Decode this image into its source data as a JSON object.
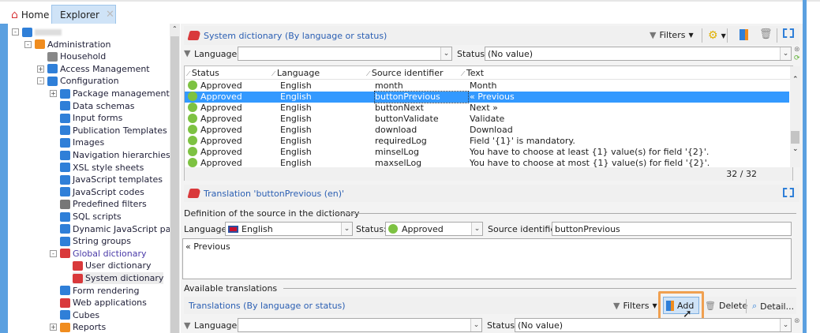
{
  "tabs": {
    "home": "Home",
    "explorer": "Explorer"
  },
  "tree": [
    {
      "label": "",
      "level": 0,
      "toggle": "-",
      "color": "#2f7fd8",
      "blurred": true
    },
    {
      "label": "Administration",
      "level": 1,
      "toggle": "-",
      "color": "#f08c1e"
    },
    {
      "label": "Household",
      "level": 2,
      "color": "#888"
    },
    {
      "label": "Access Management",
      "level": 2,
      "toggle": "+",
      "color": "#2f7fd8"
    },
    {
      "label": "Configuration",
      "level": 2,
      "toggle": "-",
      "color": "#2f7fd8"
    },
    {
      "label": "Package management",
      "level": 3,
      "toggle": "+",
      "color": "#2f7fd8"
    },
    {
      "label": "Data schemas",
      "level": 3,
      "color": "#2f7fd8"
    },
    {
      "label": "Input forms",
      "level": 3,
      "color": "#2f7fd8"
    },
    {
      "label": "Publication Templates",
      "level": 3,
      "color": "#2f7fd8"
    },
    {
      "label": "Images",
      "level": 3,
      "color": "#2f7fd8"
    },
    {
      "label": "Navigation hierarchies",
      "level": 3,
      "color": "#2f7fd8"
    },
    {
      "label": "XSL style sheets",
      "level": 3,
      "color": "#2f7fd8"
    },
    {
      "label": "JavaScript templates",
      "level": 3,
      "color": "#2f7fd8"
    },
    {
      "label": "JavaScript codes",
      "level": 3,
      "color": "#2f7fd8"
    },
    {
      "label": "Predefined filters",
      "level": 3,
      "color": "#777"
    },
    {
      "label": "SQL scripts",
      "level": 3,
      "color": "#2f7fd8"
    },
    {
      "label": "Dynamic JavaScript pages",
      "level": 3,
      "color": "#2f7fd8"
    },
    {
      "label": "String groups",
      "level": 3,
      "color": "#2f7fd8"
    },
    {
      "label": "Global dictionary",
      "level": 3,
      "toggle": "-",
      "color": "#d9393b",
      "accent": true
    },
    {
      "label": "User dictionary",
      "level": 4,
      "color": "#d9393b"
    },
    {
      "label": "System dictionary",
      "level": 4,
      "color": "#d9393b",
      "selected": true
    },
    {
      "label": "Form rendering",
      "level": 3,
      "color": "#2f7fd8"
    },
    {
      "label": "Web applications",
      "level": 3,
      "color": "#d9393b"
    },
    {
      "label": "Cubes",
      "level": 3,
      "color": "#2f7fd8"
    },
    {
      "label": "Reports",
      "level": 3,
      "toggle": "+",
      "color": "#f08c1e"
    }
  ],
  "top": {
    "title": "System dictionary (By language or status)",
    "filters": "Filters",
    "language_label": "Language:",
    "language_value": "",
    "status_label": "Status:",
    "status_value": "(No value)",
    "columns": [
      "Status",
      "Language",
      "Source identifier",
      "Text"
    ],
    "rows": [
      [
        "Approved",
        "English",
        "month",
        "Month"
      ],
      [
        "Approved",
        "English",
        "buttonPrevious",
        "« Previous"
      ],
      [
        "Approved",
        "English",
        "buttonNext",
        "Next »"
      ],
      [
        "Approved",
        "English",
        "buttonValidate",
        "Validate"
      ],
      [
        "Approved",
        "English",
        "download",
        "Download"
      ],
      [
        "Approved",
        "English",
        "requiredLog",
        "Field '{1}' is mandatory."
      ],
      [
        "Approved",
        "English",
        "minselLog",
        "You have to choose at least {1} value(s) for field '{2}'."
      ],
      [
        "Approved",
        "English",
        "maxselLog",
        "You have to choose at most {1} value(s) for field '{2}'."
      ]
    ],
    "selected_row": 1,
    "count": "32 / 32"
  },
  "detail": {
    "title": "Translation 'buttonPrevious (en)'",
    "section": "Definition of the source in the dictionary",
    "language_label": "Language:",
    "language_value": "English",
    "status_label": "Status:",
    "status_value": "Approved",
    "source_label": "Source identifier:",
    "source_value": "buttonPrevious",
    "text_value": "« Previous",
    "available": "Available translations"
  },
  "translations": {
    "title": "Translations (By language or status)",
    "filters": "Filters",
    "add": "Add",
    "delete": "Delete",
    "detail": "Detail...",
    "language_label": "Language:",
    "language_value": "",
    "status_label": "Status:",
    "status_value": "(No value)"
  },
  "colors": {
    "accent": "#3399ff",
    "approved": "#7dc242",
    "highlight": "#f0a050",
    "title": "#2b5fb3"
  }
}
